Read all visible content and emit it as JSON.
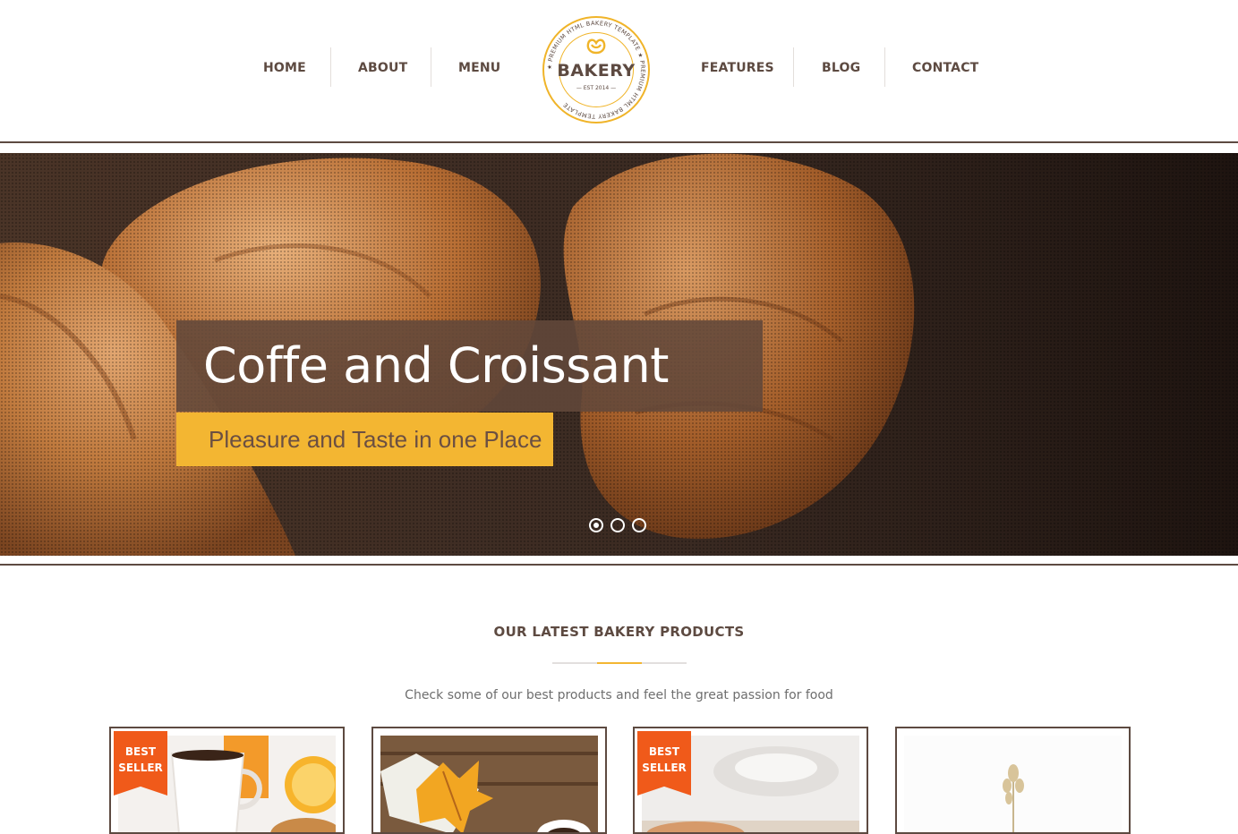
{
  "nav": {
    "left": [
      "HOME",
      "ABOUT",
      "MENU"
    ],
    "right": [
      "FEATURES",
      "BLOG",
      "CONTACT"
    ]
  },
  "logo": {
    "word": "BAKERY",
    "est": "— EST 2014 —",
    "ring_text": "★ PREMIUM HTML BAKERY TEMPLATE ★ PREMIUM HTML BAKERY TEMPLATE"
  },
  "slider": {
    "title": "Coffe and Croissant",
    "subtitle": "Pleasure and Taste in one Place",
    "dots": 3,
    "active_dot": 0
  },
  "products": {
    "title": "OUR LATEST BAKERY PRODUCTS",
    "subtitle": "Check some of our best products and feel the great passion for food",
    "cards": [
      {
        "badge": "BEST\nSELLER",
        "badge_lines": [
          "BEST",
          "SELLER"
        ]
      },
      {
        "badge": "",
        "badge_lines": []
      },
      {
        "badge": "BEST\nSELLER",
        "badge_lines": [
          "BEST",
          "SELLER"
        ]
      },
      {
        "badge": "",
        "badge_lines": []
      }
    ]
  },
  "colors": {
    "brand_brown": "#5d4a41",
    "accent_yellow": "#f3b632",
    "badge_orange": "#f05a1a"
  },
  "icons": [
    "pretzel-icon"
  ]
}
